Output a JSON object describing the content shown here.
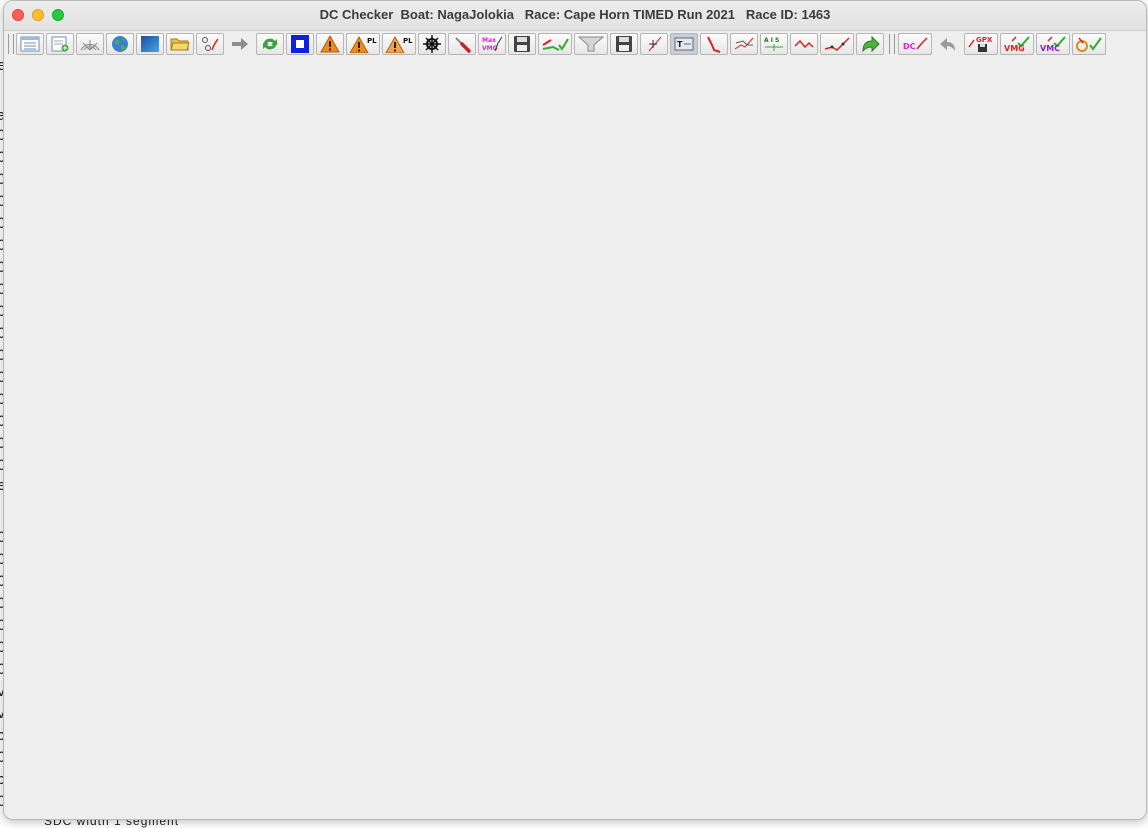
{
  "window": {
    "title": "DC Checker  Boat: NagaJolokia   Race: Cape Horn TIMED Run 2021   Race ID: 1463"
  },
  "background_window": {
    "bottom_text": "SDC  width 1  segment"
  },
  "toolbar": {
    "group1": [
      {
        "name": "list-view-button",
        "icon": "list-icon"
      },
      {
        "name": "new-document-button",
        "icon": "document-add-icon"
      },
      {
        "name": "polar-chart-button",
        "icon": "polar-chart-icon"
      },
      {
        "name": "globe-button",
        "icon": "globe-icon"
      },
      {
        "name": "map-view-button",
        "icon": "blue-square-icon"
      },
      {
        "name": "open-folder-button",
        "icon": "folder-icon"
      },
      {
        "name": "route-points-button",
        "icon": "route-points-icon"
      },
      {
        "name": "forward-button",
        "icon": "arrow-right-icon"
      },
      {
        "name": "refresh-button",
        "icon": "refresh-icon"
      },
      {
        "name": "stop-button",
        "icon": "stop-icon"
      },
      {
        "name": "warning-button",
        "icon": "warning-icon"
      },
      {
        "name": "warning-pl-button",
        "icon": "warning-pl-icon"
      },
      {
        "name": "warning-pl-alt-button",
        "icon": "warning-pl-alt-icon"
      },
      {
        "name": "helm-button",
        "icon": "ship-wheel-icon"
      },
      {
        "name": "tool-button",
        "icon": "screwdriver-icon"
      },
      {
        "name": "max-vmg-button",
        "icon": "max-vmg-icon"
      },
      {
        "name": "save-button",
        "icon": "floppy-disk-icon"
      },
      {
        "name": "route-check-button",
        "icon": "route-check-icon"
      },
      {
        "name": "filter-button",
        "icon": "funnel-icon"
      },
      {
        "name": "save-alt-button",
        "icon": "floppy-disk-icon"
      },
      {
        "name": "waypoint-button",
        "icon": "waypoint-icon"
      },
      {
        "name": "text-button",
        "icon": "text-box-icon"
      },
      {
        "name": "track-red-button",
        "icon": "track-red-icon"
      },
      {
        "name": "route-compare-button",
        "icon": "route-compare-icon"
      },
      {
        "name": "ais-button",
        "icon": "ais-icon"
      },
      {
        "name": "zigzag-button",
        "icon": "zigzag-icon"
      },
      {
        "name": "trend-button",
        "icon": "trend-icon"
      },
      {
        "name": "redo-button",
        "icon": "redo-arrow-icon"
      }
    ],
    "group2": [
      {
        "name": "dc-button",
        "icon": "dc-icon"
      },
      {
        "name": "undo-button",
        "icon": "undo-arrow-icon"
      },
      {
        "name": "gpx-save-button",
        "icon": "gpx-icon"
      },
      {
        "name": "vmg-button",
        "icon": "vmg-icon"
      },
      {
        "name": "vmc-button",
        "icon": "vmc-icon"
      },
      {
        "name": "route-ok-button",
        "icon": "route-ok-icon"
      }
    ],
    "labels": {
      "warning_pl": "PL",
      "max_vmg_top": "Max",
      "max_vmg_bottom": "VMG",
      "ais": "A I S",
      "dc": "DC",
      "gpx": "GPX",
      "vmg": "VMG",
      "vmc": "VMC"
    }
  }
}
